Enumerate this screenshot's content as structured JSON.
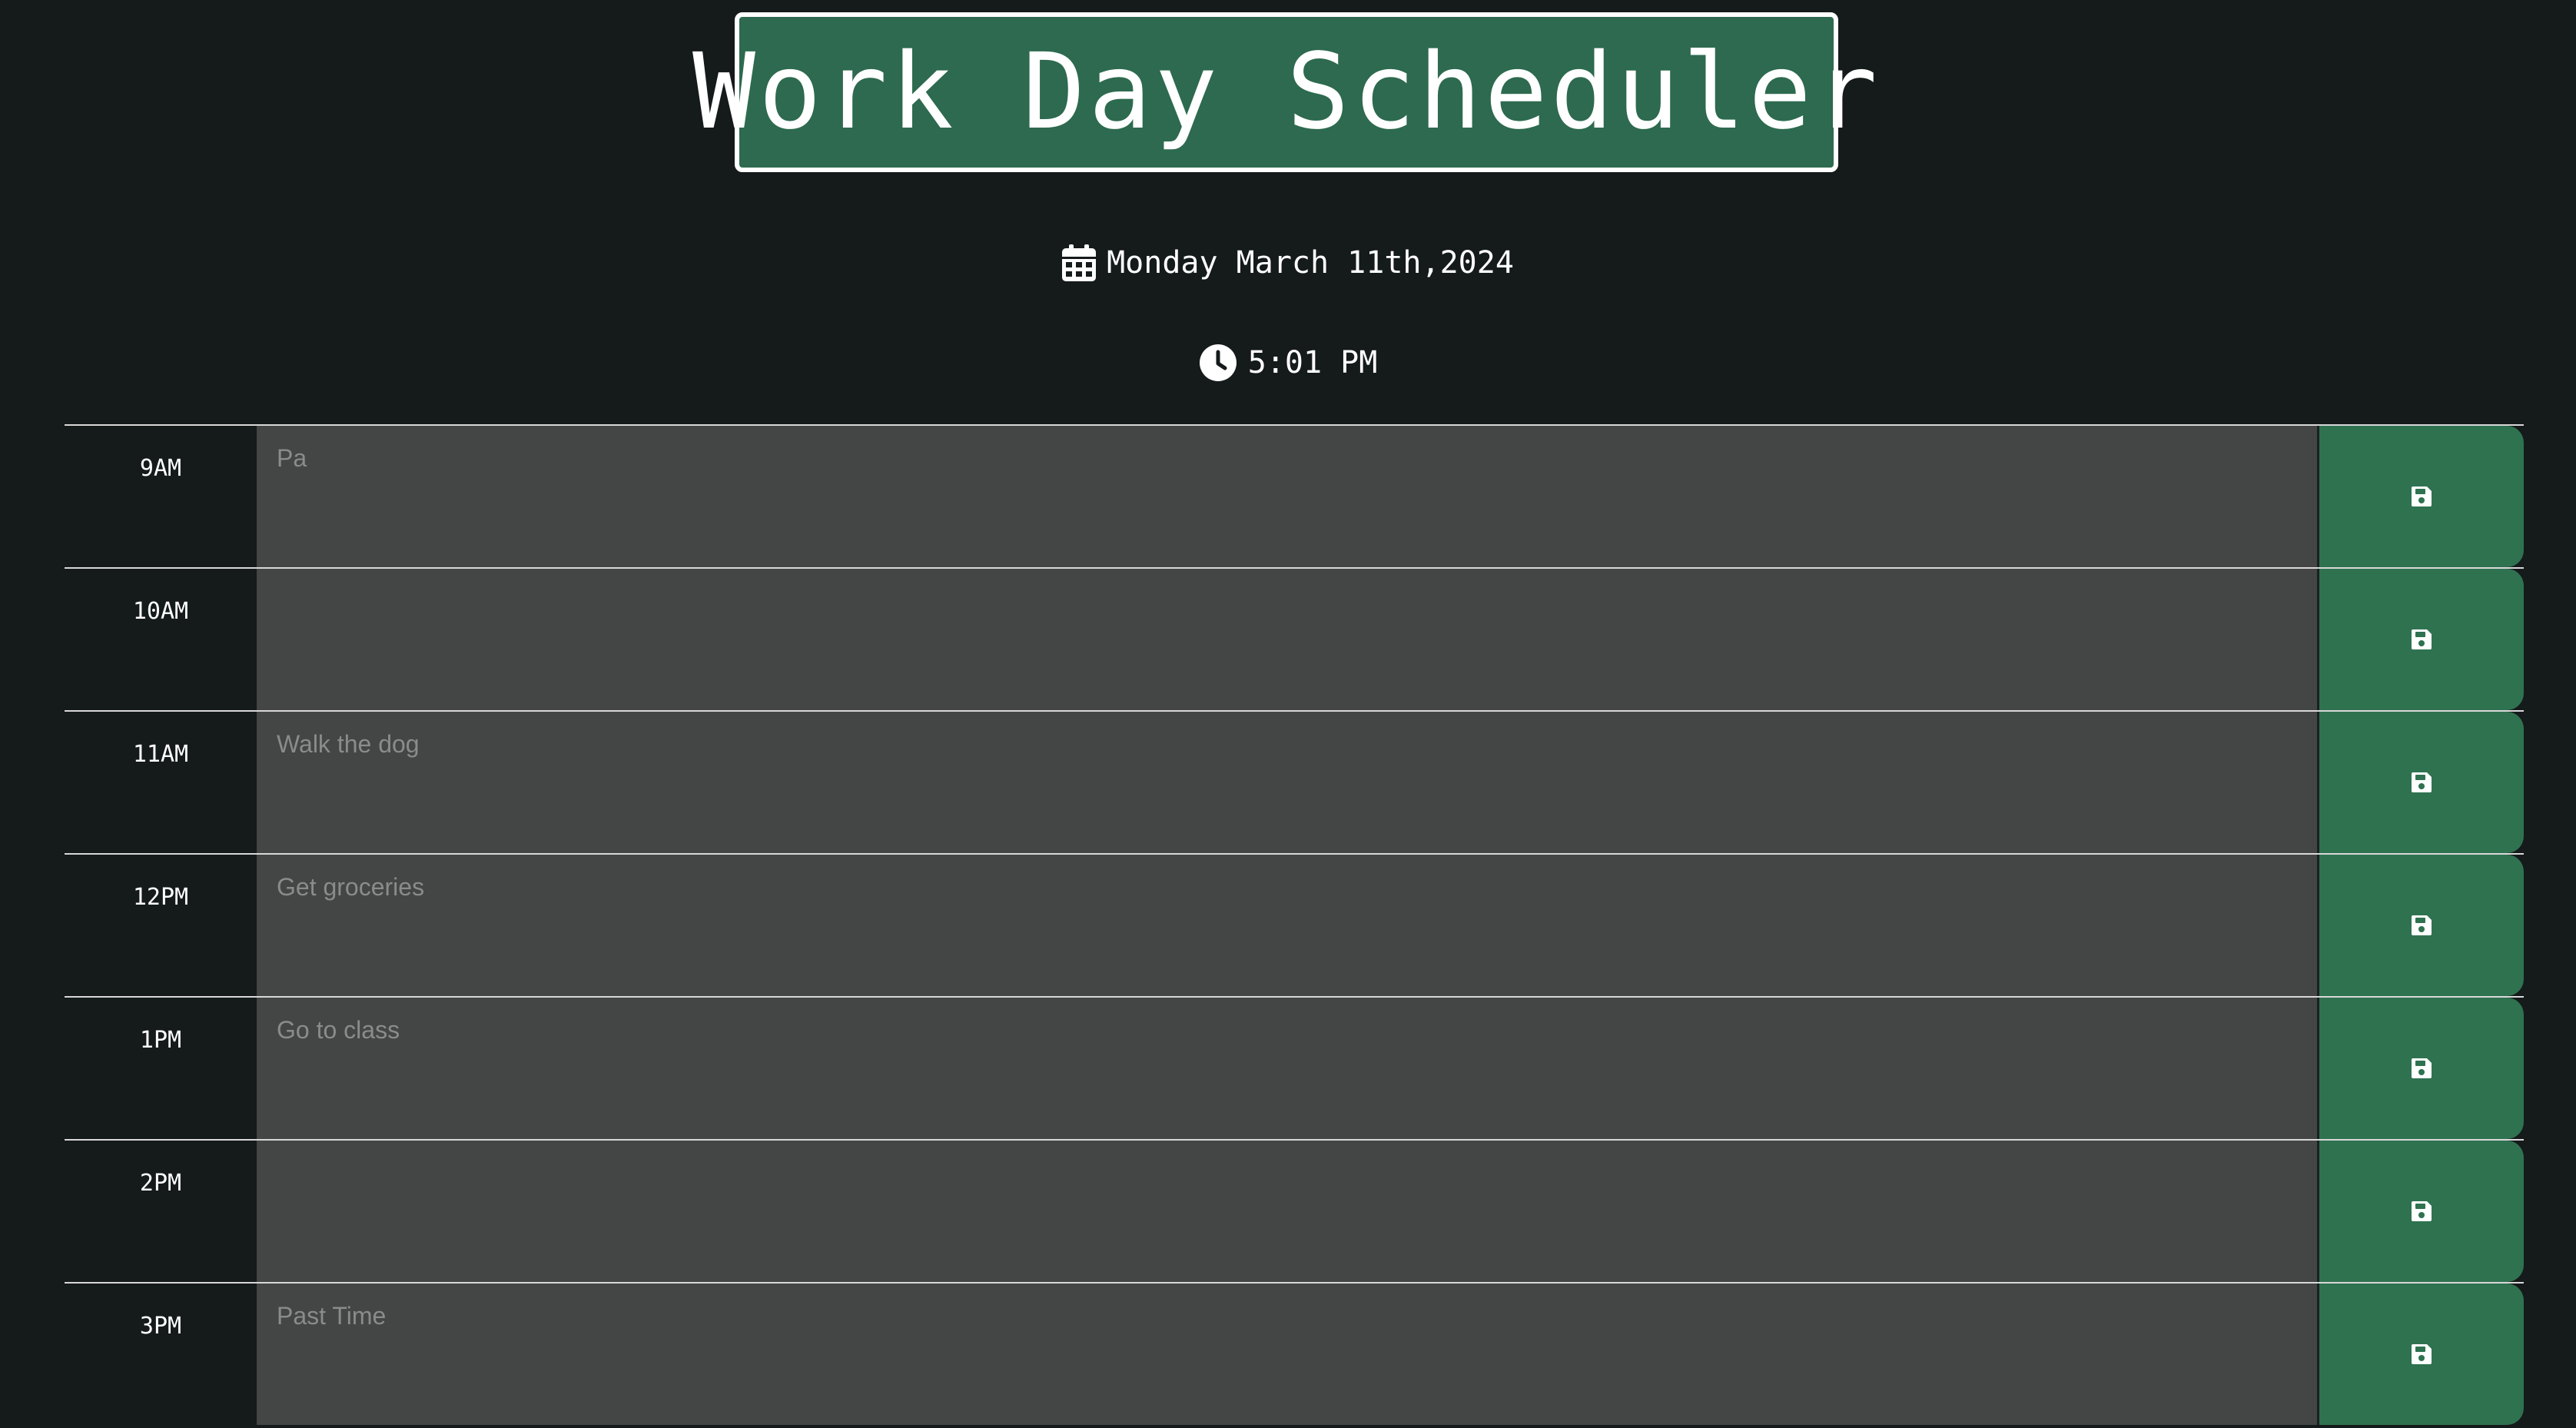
{
  "header": {
    "title": "Work Day Scheduler",
    "date_icon": "calendar-icon",
    "date": "Monday March 11th,2024",
    "time_icon": "clock-icon",
    "time": "5:01 PM"
  },
  "colors": {
    "background": "#151a1b",
    "accent": "#2d6a4f",
    "save_button": "#2f7250",
    "task_field": "#444545",
    "placeholder": "#8a8b8b"
  },
  "time_blocks": [
    {
      "hour": "9AM",
      "placeholder": "Pa",
      "value": "",
      "save_icon": "floppy-disk-icon"
    },
    {
      "hour": "10AM",
      "placeholder": "",
      "value": "",
      "save_icon": "floppy-disk-icon"
    },
    {
      "hour": "11AM",
      "placeholder": "Walk the dog",
      "value": "",
      "save_icon": "floppy-disk-icon"
    },
    {
      "hour": "12PM",
      "placeholder": "Get groceries",
      "value": "",
      "save_icon": "floppy-disk-icon"
    },
    {
      "hour": "1PM",
      "placeholder": "Go to class",
      "value": "",
      "save_icon": "floppy-disk-icon"
    },
    {
      "hour": "2PM",
      "placeholder": "",
      "value": "",
      "save_icon": "floppy-disk-icon"
    },
    {
      "hour": "3PM",
      "placeholder": "Past Time",
      "value": "",
      "save_icon": "floppy-disk-icon"
    }
  ]
}
